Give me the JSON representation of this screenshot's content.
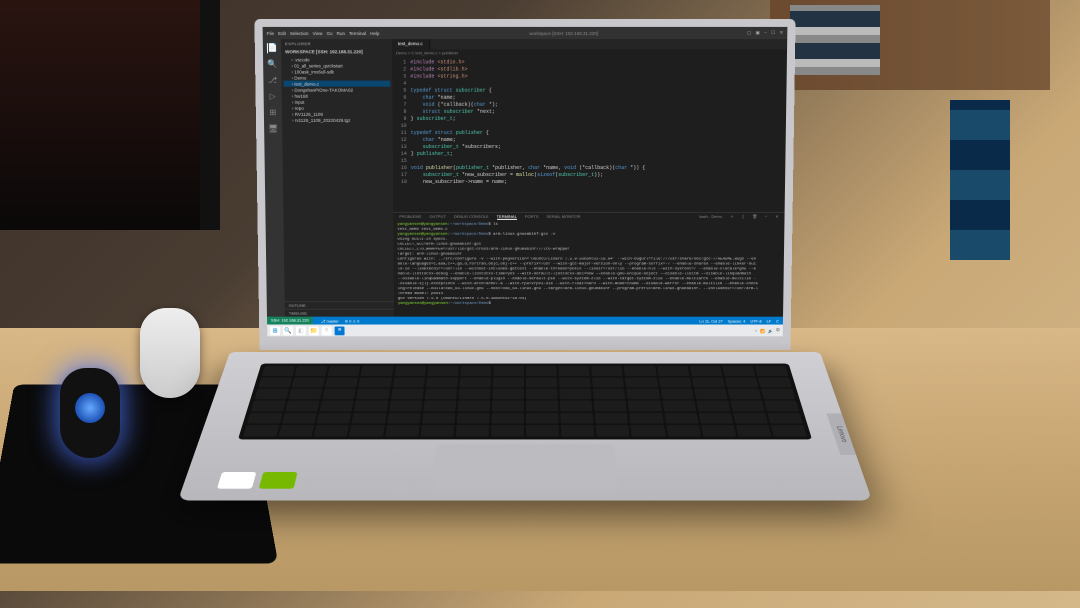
{
  "scene": {
    "laptop_brand": "Lenovo",
    "stickers": {
      "nvidia": "NVIDIA",
      "dolby": "DOLBY AUDIO"
    }
  },
  "vscode": {
    "menu": [
      "File",
      "Edit",
      "Selection",
      "View",
      "Go",
      "Run",
      "Terminal",
      "Help"
    ],
    "window_title": "workspace [SSH: 192.168.31.220]",
    "explorer": {
      "title": "EXPLORER",
      "workspace": "WORKSPACE [SSH: 192.168.31.220]",
      "items": [
        {
          "label": ".vscode"
        },
        {
          "label": "01_all_series_quickstart"
        },
        {
          "label": "100ask_imx6ull-sdk"
        },
        {
          "label": "Demo"
        },
        {
          "label": "test_demo.c",
          "selected": true
        },
        {
          "label": "DongshanPiOne-TAKOMA02"
        },
        {
          "label": "hw168"
        },
        {
          "label": "input"
        },
        {
          "label": "repo"
        },
        {
          "label": "RV1126_1109"
        },
        {
          "label": "rv1126_1109_20220429.tgz"
        }
      ],
      "footer": [
        "OUTLINE",
        "TIMELINE"
      ]
    },
    "editor": {
      "tab": "test_demo.c",
      "breadcrumb": "Demo > C test_demo.c > publisher",
      "lines": [
        {
          "n": 1,
          "html": "<span class='m'>#include</span> <span class='s'>&lt;stdio.h&gt;</span>"
        },
        {
          "n": 2,
          "html": "<span class='m'>#include</span> <span class='s'>&lt;stdlib.h&gt;</span>"
        },
        {
          "n": 3,
          "html": "<span class='m'>#include</span> <span class='s'>&lt;string.h&gt;</span>"
        },
        {
          "n": 4,
          "html": ""
        },
        {
          "n": 5,
          "html": "<span class='k'>typedef struct</span> <span class='t'>subscriber</span> {"
        },
        {
          "n": 6,
          "html": "    <span class='k'>char</span> *name;"
        },
        {
          "n": 7,
          "html": "    <span class='k'>void</span> (*callback)(<span class='k'>char</span> *);"
        },
        {
          "n": 8,
          "html": "    <span class='k'>struct</span> <span class='t'>subscriber</span> *next;"
        },
        {
          "n": 9,
          "html": "} <span class='t'>subscriber_t</span>;"
        },
        {
          "n": 10,
          "html": ""
        },
        {
          "n": 11,
          "html": "<span class='k'>typedef struct</span> <span class='t'>publisher</span> {"
        },
        {
          "n": 12,
          "html": "    <span class='k'>char</span> *name;"
        },
        {
          "n": 13,
          "html": "    <span class='t'>subscriber_t</span> *subscribers;"
        },
        {
          "n": 14,
          "html": "} <span class='t'>publisher_t</span>;"
        },
        {
          "n": 15,
          "html": ""
        },
        {
          "n": 16,
          "html": "<span class='k'>void</span> <span class='f'>publisher</span>(<span class='t'>publisher_t</span> *publisher, <span class='k'>char</span> *name, <span class='k'>void</span> (*callback)(<span class='k'>char</span> *)) {"
        },
        {
          "n": 17,
          "html": "    <span class='t'>subscriber_t</span> *new_subscriber = <span class='f'>malloc</span>(<span class='k'>sizeof</span>(<span class='t'>subscriber_t</span>));"
        },
        {
          "n": 18,
          "html": "    new_subscriber-&gt;name = name;"
        }
      ]
    },
    "panel": {
      "tabs": [
        "PROBLEMS",
        "OUTPUT",
        "DEBUG CONSOLE",
        "TERMINAL",
        "PORTS",
        "SERIAL MONITOR"
      ],
      "active": "TERMINAL",
      "shell_label": "bash - Demo",
      "lines": [
        {
          "prompt": "yangyansen@yangyansen",
          "path": "~/workspace/Demo",
          "cmd": "ls"
        },
        {
          "out": "test_demo  test_demo.c"
        },
        {
          "prompt": "yangyansen@yangyansen",
          "path": "~/workspace/Demo",
          "cmd": "arm-linux-gnueabihf-gcc -v"
        },
        {
          "out": "Using built-in specs."
        },
        {
          "out": "COLLECT_GCC=arm-linux-gnueabihf-gcc"
        },
        {
          "out": "COLLECT_LTO_WRAPPER=/usr/lib/gcc-cross/arm-linux-gnueabihf/7/lto-wrapper"
        },
        {
          "out": "Target: arm-linux-gnueabihf"
        },
        {
          "out": "Configured with: ../src/configure -v --with-pkgversion='Ubuntu/Linaro 7.5.0-3ubuntu1~18.04' --with-bugurl=file:///usr/share/doc/gcc-7/README.Bugs --en"
        },
        {
          "out": "able-languages=c,ada,c++,go,d,fortran,objc,obj-c++ --prefix=/usr --with-gcc-major-version-only --program-suffix=-7 --enable-shared --enable-linker-bui"
        },
        {
          "out": "ld-id --libexecdir=/usr/lib --without-included-gettext --enable-threads=posix --libdir=/usr/lib --enable-nls --with-sysroot=/ --enable-clocale=gnu --e"
        },
        {
          "out": "nable-libstdcxx-debug --enable-libstdcxx-time=yes --with-default-libstdcxx-abi=new --enable-gnu-unique-object --disable-libitm --disable-libquadmath"
        },
        {
          "out": "--disable-libquadmath-support --enable-plugin --enable-default-pie --with-system-zlib --with-target-system-zlib --enable-multiarch --enable-multilib -"
        },
        {
          "out": "-disable-sjlj-exceptions --with-arch=armv7-a --with-fpu=vfpv3-d16 --with-float=hard --with-mode=thumb --disable-werror --enable-multilib --enable-check"
        },
        {
          "out": "ing=release --build=x86_64-linux-gnu --host=x86_64-linux-gnu --target=arm-linux-gnueabihf --program-prefix=arm-linux-gnueabihf- --includedir=/usr/arm-l"
        },
        {
          "out": "Thread model: posix"
        },
        {
          "out": "gcc version 7.5.0 (Ubuntu/Linaro 7.5.0-3ubuntu1~18.04)"
        },
        {
          "prompt": "yangyansen@yangyansen",
          "path": "~/workspace/Demo",
          "cmd": ""
        }
      ]
    },
    "status": {
      "remote": "SSH: 192.168.31.220",
      "branch": "master",
      "errors": "0",
      "warnings": "0",
      "right": [
        "Ln 11, Col 27",
        "Spaces: 4",
        "UTF-8",
        "LF",
        "C"
      ]
    }
  },
  "taskbar": {
    "apps": [
      "start",
      "search",
      "task",
      "explorer",
      "edge",
      "store",
      "mail",
      "vscode"
    ]
  }
}
